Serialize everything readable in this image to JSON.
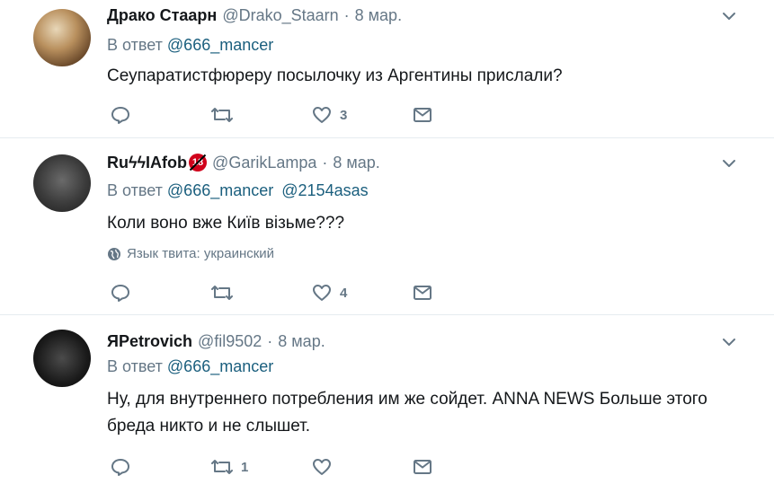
{
  "tweets": [
    {
      "name": "Драко Стаарн",
      "handle": "@Drako_Staarn",
      "dot": "·",
      "time": "8 мар.",
      "reply_prefix": "В ответ",
      "mentions": [
        "@666_mancer"
      ],
      "text": "Сеупаратистфюреру посылочку из Аргентины прислали?",
      "reply_count": "",
      "retweet_count": "",
      "like_count": "3"
    },
    {
      "name": "RuϟϟIAfob",
      "badge": "18",
      "handle": "@GarikLampa",
      "dot": "·",
      "time": "8 мар.",
      "reply_prefix": "В ответ",
      "mentions": [
        "@666_mancer",
        "@2154asas"
      ],
      "text": "Коли воно вже Київ візьме???",
      "language_note": "Язык твита: украинский",
      "reply_count": "",
      "retweet_count": "",
      "like_count": "4"
    },
    {
      "name": "ЯPetrovich",
      "handle": "@fil9502",
      "dot": "·",
      "time": "8 мар.",
      "reply_prefix": "В ответ",
      "mentions": [
        "@666_mancer"
      ],
      "text": "Ну, для внутреннего потребления им же сойдет. ANNA NEWS  Больше этого бреда никто и не слышет.",
      "reply_count": "",
      "retweet_count": "1",
      "like_count": ""
    }
  ],
  "icons": {
    "reply": "reply-icon",
    "retweet": "retweet-icon",
    "like": "heart-icon",
    "dm": "envelope-icon",
    "menu": "chevron-down-icon",
    "globe": "globe-icon"
  },
  "colors": {
    "text": "#14171a",
    "muted": "#657786",
    "mention": "#1b5f7e",
    "divider": "#e6ecf0",
    "badge": "#d0021b"
  }
}
